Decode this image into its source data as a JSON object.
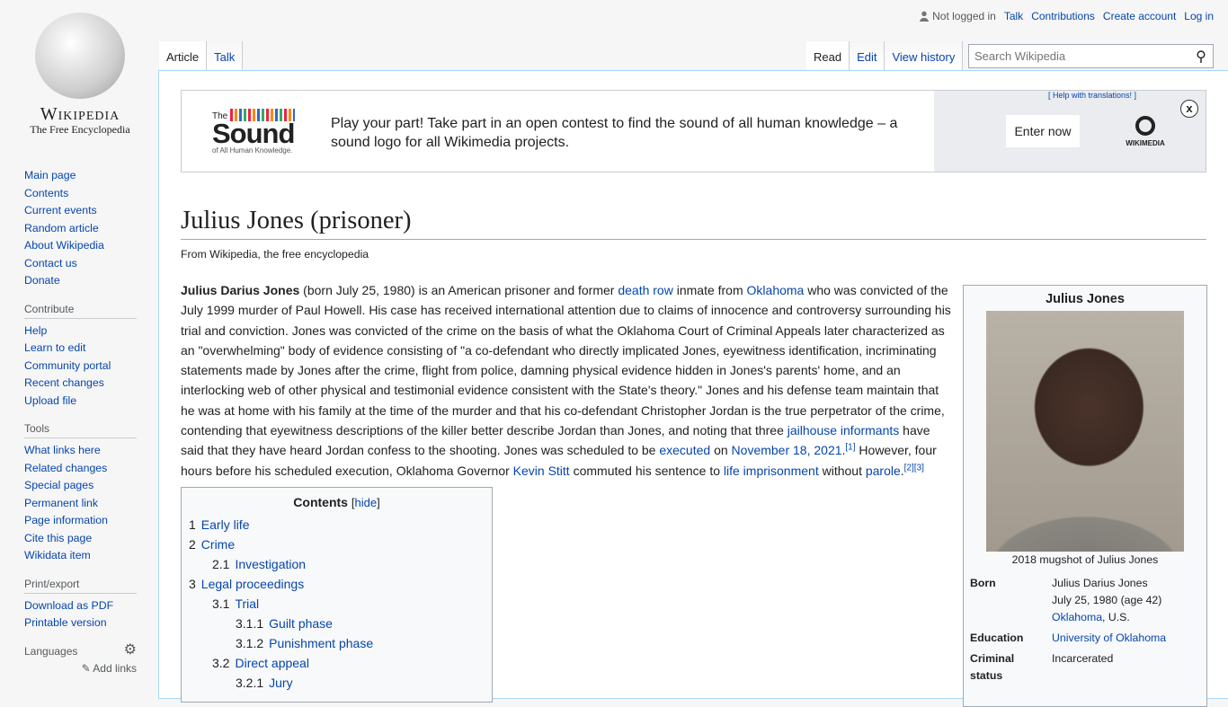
{
  "logo": {
    "wordmark": "Wikipedia",
    "tagline": "The Free Encyclopedia"
  },
  "sidebar": {
    "nav": [
      "Main page",
      "Contents",
      "Current events",
      "Random article",
      "About Wikipedia",
      "Contact us",
      "Donate"
    ],
    "contribute": {
      "heading": "Contribute",
      "items": [
        "Help",
        "Learn to edit",
        "Community portal",
        "Recent changes",
        "Upload file"
      ]
    },
    "tools": {
      "heading": "Tools",
      "items": [
        "What links here",
        "Related changes",
        "Special pages",
        "Permanent link",
        "Page information",
        "Cite this page",
        "Wikidata item"
      ]
    },
    "print": {
      "heading": "Print/export",
      "items": [
        "Download as PDF",
        "Printable version"
      ]
    },
    "languages": {
      "heading": "Languages",
      "add_links": "Add links"
    }
  },
  "personal": {
    "not_logged_in": "Not logged in",
    "links": [
      "Talk",
      "Contributions",
      "Create account",
      "Log in"
    ]
  },
  "tabs": {
    "left": [
      "Article",
      "Talk"
    ],
    "right": [
      "Read",
      "Edit",
      "View history"
    ]
  },
  "search": {
    "placeholder": "Search Wikipedia"
  },
  "banner": {
    "logo_the": "The",
    "logo_sound": "Sound",
    "logo_sub": "of All Human Knowledge.",
    "message": "Play your part! Take part in an open contest to find the sound of all human knowledge – a sound logo for all Wikimedia projects.",
    "enter": "Enter now",
    "help": "[ Help with translations! ]",
    "wikimedia": "WIKIMEDIA",
    "close": "x"
  },
  "article": {
    "title": "Julius Jones (prisoner)",
    "from": "From Wikipedia, the free encyclopedia",
    "segments": [
      {
        "t": "Julius Darius Jones",
        "b": true
      },
      {
        "t": " (born July 25, 1980) is an American prisoner and former "
      },
      {
        "t": "death row",
        "l": true
      },
      {
        "t": " inmate from "
      },
      {
        "t": "Oklahoma",
        "l": true
      },
      {
        "t": " who was convicted of the July 1999 murder of Paul Howell. His case has received international attention due to claims of innocence and controversy surrounding his trial and conviction. Jones was convicted of the crime on the basis of what the Oklahoma Court of Criminal Appeals later characterized as an \"overwhelming\" body of evidence consisting of \"a co-defendant who directly implicated Jones, eyewitness identification, incriminating statements made by Jones after the crime, flight from police, damning physical evidence hidden in Jones's parents' home, and an interlocking web of other physical and testimonial evidence consistent with the State's theory.\" Jones and his defense team maintain that he was at home with his family at the time of the murder and that his co-defendant Christopher Jordan is the true perpetrator of the crime, contending that eyewitness descriptions of the killer better describe Jordan than Jones, and noting that three "
      },
      {
        "t": "jailhouse informants",
        "l": true
      },
      {
        "t": " have said that they have heard Jordan confess to the shooting. Jones was scheduled to be "
      },
      {
        "t": "executed",
        "l": true
      },
      {
        "t": " on "
      },
      {
        "t": "November 18, 2021",
        "l": true
      },
      {
        "t": ".",
        "s": false
      },
      {
        "t": "[1]",
        "l": true,
        "sup": true
      },
      {
        "t": " However, four hours before his scheduled execution, Oklahoma Governor "
      },
      {
        "t": "Kevin Stitt",
        "l": true
      },
      {
        "t": " commuted his sentence to "
      },
      {
        "t": "life imprisonment",
        "l": true
      },
      {
        "t": " without "
      },
      {
        "t": "parole",
        "l": true
      },
      {
        "t": "."
      },
      {
        "t": "[2]",
        "l": true,
        "sup": true
      },
      {
        "t": "[3]",
        "l": true,
        "sup": true
      }
    ]
  },
  "toc": {
    "title": "Contents",
    "hide": "hide",
    "items": [
      {
        "n": "1",
        "t": "Early life",
        "lvl": 0
      },
      {
        "n": "2",
        "t": "Crime",
        "lvl": 0
      },
      {
        "n": "2.1",
        "t": "Investigation",
        "lvl": 1
      },
      {
        "n": "3",
        "t": "Legal proceedings",
        "lvl": 0
      },
      {
        "n": "3.1",
        "t": "Trial",
        "lvl": 1
      },
      {
        "n": "3.1.1",
        "t": "Guilt phase",
        "lvl": 2
      },
      {
        "n": "3.1.2",
        "t": "Punishment phase",
        "lvl": 2
      },
      {
        "n": "3.2",
        "t": "Direct appeal",
        "lvl": 1
      },
      {
        "n": "3.2.1",
        "t": "Jury",
        "lvl": 2
      }
    ]
  },
  "infobox": {
    "title": "Julius Jones",
    "caption": "2018 mugshot of Julius Jones",
    "born_label": "Born",
    "born_name": "Julius Darius Jones",
    "born_date": "July 25, 1980 (age 42)",
    "born_place_link": "Oklahoma",
    "born_place_rest": ", U.S.",
    "education_label": "Education",
    "education": "University of Oklahoma",
    "status_label": "Criminal status",
    "status": "Incarcerated"
  }
}
